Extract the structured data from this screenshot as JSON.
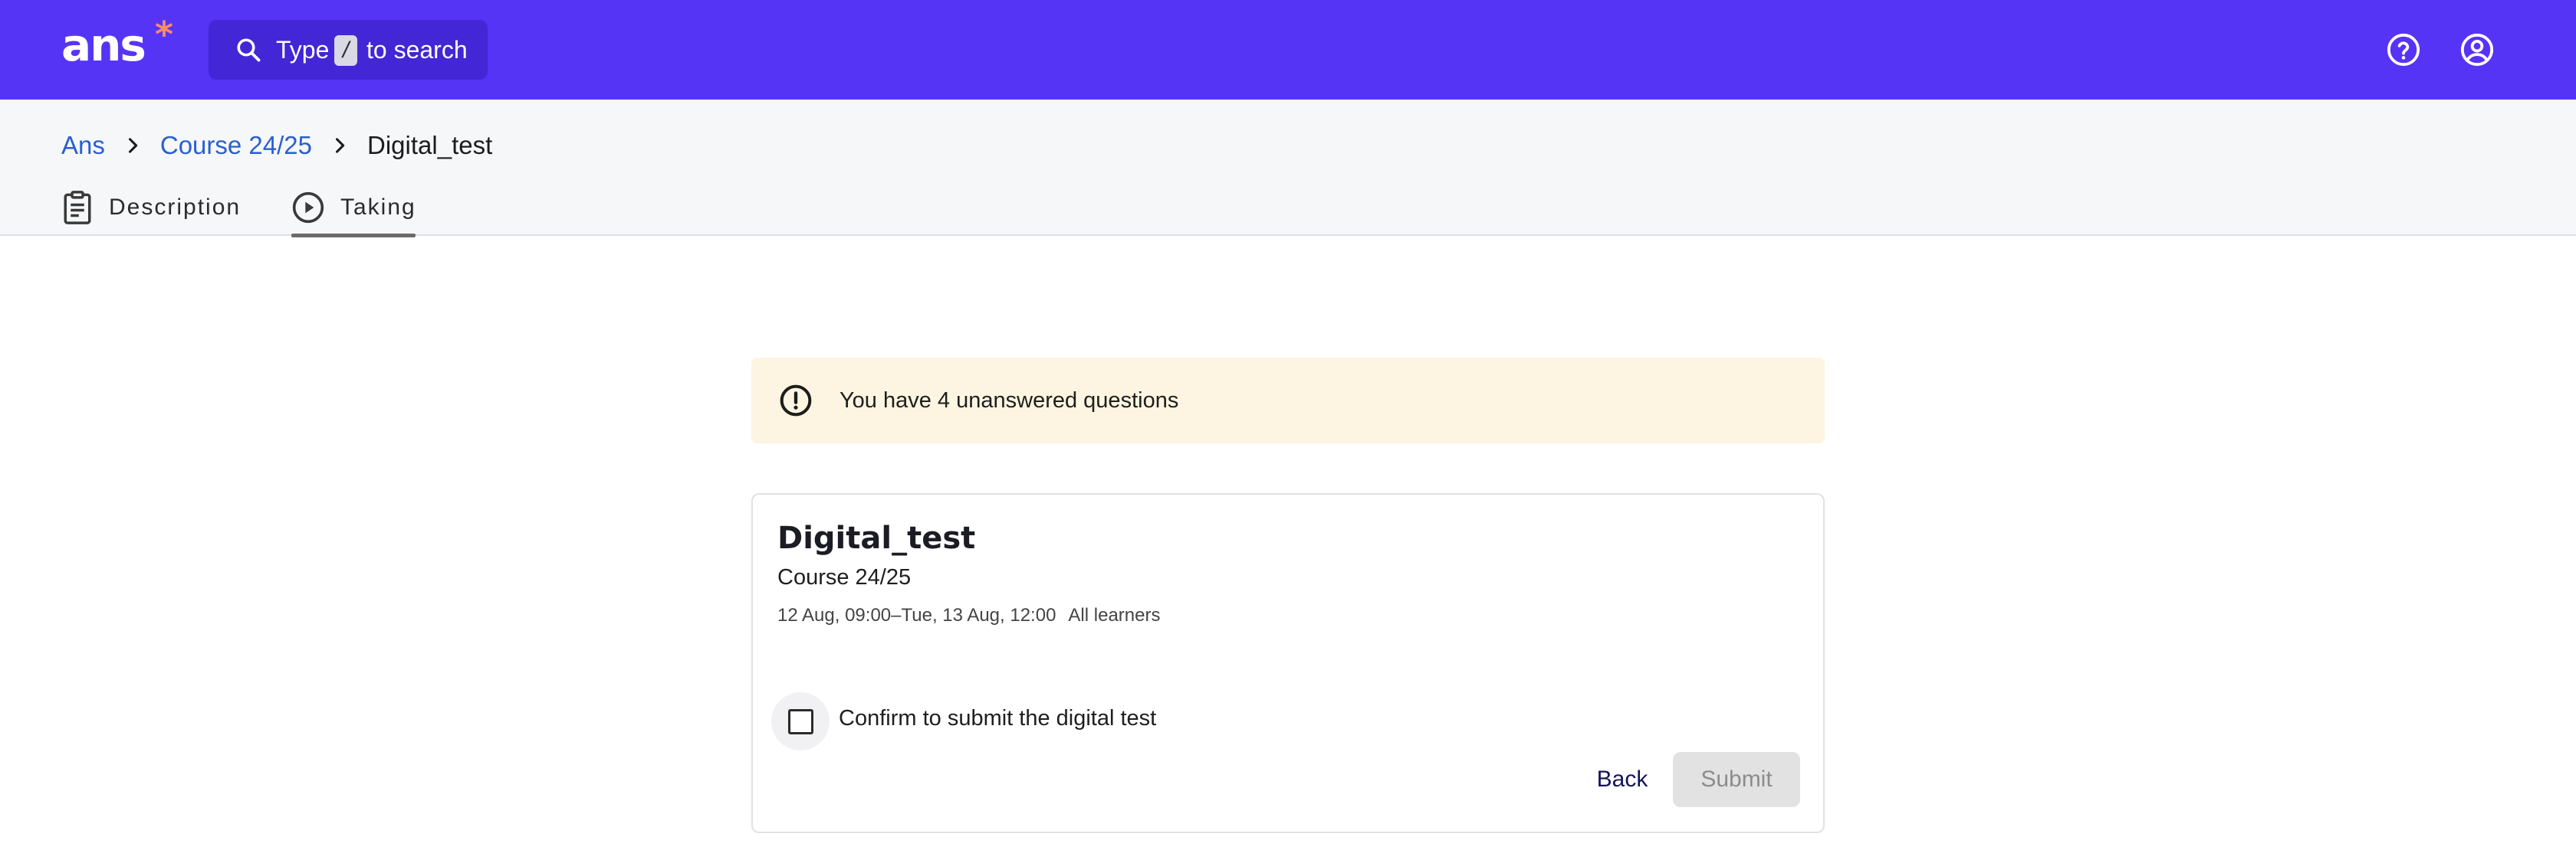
{
  "header": {
    "logo_text": "ans",
    "logo_mark": "*",
    "search": {
      "prefix": "Type",
      "key": "/",
      "suffix": "to search",
      "icon": "search-icon"
    },
    "icons": [
      "help-icon",
      "user-account-icon"
    ],
    "brand_color": "#5634f6"
  },
  "breadcrumb": [
    {
      "label": "Ans"
    },
    {
      "label": "Course 24/25"
    },
    {
      "label": "Digital_test"
    }
  ],
  "tabs": [
    {
      "label": "Description",
      "icon": "clipboard-icon"
    },
    {
      "label": "Taking",
      "icon": "play-circle-icon",
      "active": true
    }
  ],
  "alert": {
    "text": "You have 4 unanswered questions",
    "icon": "exclamation-circle-icon",
    "background": "#fdf5e1"
  },
  "card": {
    "title": "Digital_test",
    "course": "Course 24/25",
    "schedule": "12 Aug, 09:00–Tue, 13 Aug, 12:00",
    "audience": "All learners",
    "confirm_label": "Confirm to submit the digital test",
    "confirm_checked": false,
    "back_label": "Back",
    "submit_label": "Submit"
  }
}
